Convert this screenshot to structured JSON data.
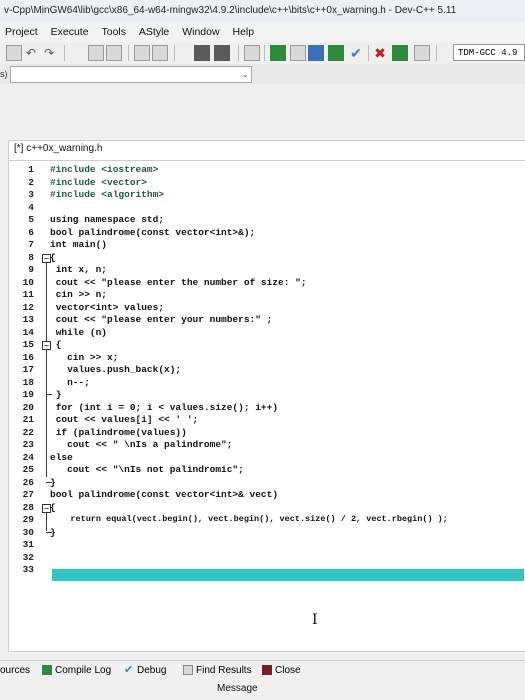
{
  "window": {
    "title": "v-Cpp\\MinGW64\\lib\\gcc\\x86_64-w64-mingw32\\4.9.2\\include\\c++\\bits\\c++0x_warning.h - Dev-C++ 5.11"
  },
  "menu": [
    "Project",
    "Execute",
    "Tools",
    "AStyle",
    "Window",
    "Help"
  ],
  "toolbar": {
    "compiler": "TDM-GCC 4.9"
  },
  "scope_combo": {
    "arrow": "⌄"
  },
  "left_fragment": "s)",
  "editor": {
    "tab_label": "[*] c++0x_warning.h",
    "line_numbers": [
      "1",
      "2",
      "3",
      "4",
      "5",
      "6",
      "7",
      "8",
      "9",
      "10",
      "11",
      "12",
      "13",
      "14",
      "15",
      "16",
      "17",
      "18",
      "19",
      "20",
      "21",
      "22",
      "23",
      "24",
      "25",
      "26",
      "27",
      "28",
      "29",
      "30",
      "31",
      "32",
      "33"
    ],
    "lines": [
      "#include <iostream>",
      "#include <vector>",
      "#include <algorithm>",
      "",
      "using namespace std;",
      "bool palindrome(const vector<int>&);",
      "int main()",
      "{",
      " int x, n;",
      " cout << \"please enter the number of size: \";",
      " cin >> n;",
      " vector<int> values;",
      " cout << \"please enter your numbers:\" ;",
      " while (n)",
      " {",
      "   cin >> x;",
      "   values.push_back(x);",
      "   n--;",
      " }",
      " for (int i = 0; i < values.size(); i++)",
      " cout << values[i] << ' ';",
      " if (palindrome(values))",
      "   cout << \" \\nIs a palindrome\";",
      "else",
      "   cout << \"\\nIs not palindromic\";",
      "}",
      "bool palindrome(const vector<int>& vect)",
      "{",
      "    return equal(vect.begin(), vect.begin(), vect.size() / 2, vect.rbegin() );",
      "}",
      "",
      "",
      ""
    ],
    "text_cursor": "I"
  },
  "bottom_tabs": [
    "ources",
    "Compile Log",
    "Debug",
    "Find Results",
    "Close"
  ],
  "message_header": "Message"
}
